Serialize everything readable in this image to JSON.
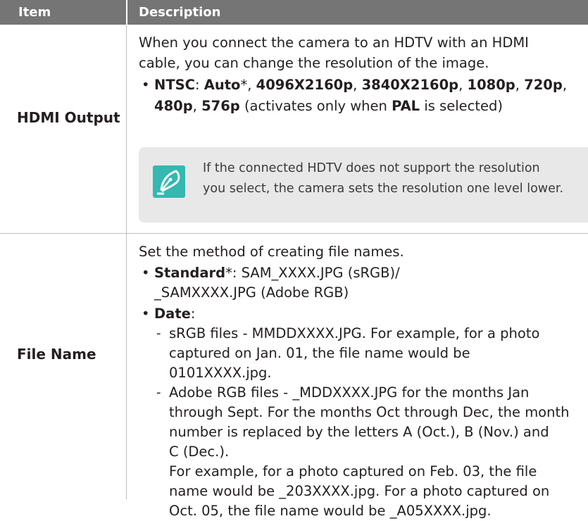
{
  "header": {
    "item": "Item",
    "description": "Description"
  },
  "rows": [
    {
      "item": "HDMI Output",
      "intro": [
        "When you connect the camera to an HDTV with an HDMI",
        "cable, you can change the resolution of the image."
      ],
      "bullet": {
        "line1": {
          "t1": "NTSC",
          "t2": ": ",
          "t3": "Auto",
          "t4": "*, ",
          "t5": "4096X2160p",
          "t6": ", ",
          "t7": "3840X2160p",
          "t8": ", ",
          "t9": "1080p",
          "t10": ", ",
          "t11": "720p",
          "t12": ","
        },
        "line2": {
          "t1": "480p",
          "t2": ", ",
          "t3": "576p",
          "t4": " (activates only when ",
          "t5": "PAL",
          "t6": " is selected)"
        }
      },
      "note": [
        "If the connected HDTV does not support the resolution",
        "you select, the camera sets the resolution one level lower."
      ],
      "note_icon": "pen-nib-icon"
    },
    {
      "item": "File Name",
      "intro": "Set the method of creating file names.",
      "standard": {
        "label": "Standard",
        "suffix": "*: SAM_XXXX.JPG (sRGB)/",
        "line2": "_SAMXXXX.JPG (Adobe RGB)"
      },
      "date": {
        "label": "Date",
        "suffix": ":",
        "srgb": [
          "sRGB files - MMDDXXXX.JPG. For example, for a photo",
          "captured on Jan. 01, the file name would be",
          "0101XXXX.jpg."
        ],
        "adobe": [
          "Adobe RGB files - _MDDXXXX.JPG for the months Jan",
          "through Sept. For the months Oct through Dec, the month",
          "number is replaced by the letters A (Oct.), B (Nov.) and",
          "C (Dec.).",
          "For example, for a photo captured on Feb. 03, the file",
          "name would be _203XXXX.jpg. For a photo captured on",
          "Oct. 05, the file name would be _A05XXXX.jpg."
        ]
      },
      "bullet_glyph": "•",
      "dash_glyph": "-"
    }
  ]
}
